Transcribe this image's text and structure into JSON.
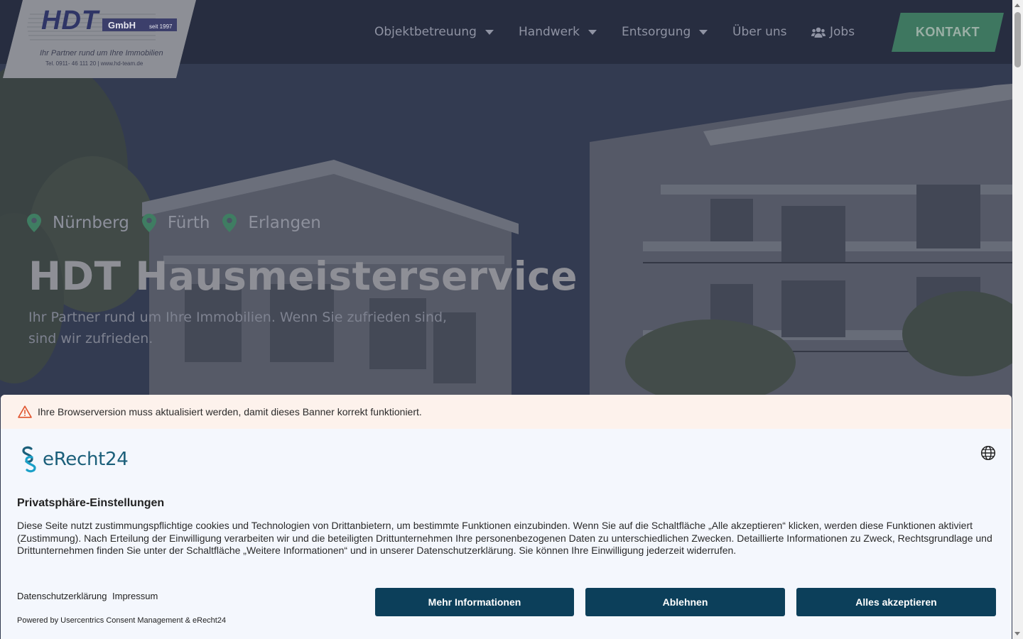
{
  "header": {
    "logo": {
      "brand": "HDT",
      "suffix": "GmbH",
      "since": "seit 1997",
      "tagline": "Ihr Partner rund um Ihre Immobilien",
      "contact": "Tel. 0911- 46 111 20 | www.hd-team.de"
    },
    "nav": [
      {
        "label": "Objektbetreuung",
        "dropdown": true
      },
      {
        "label": "Handwerk",
        "dropdown": true
      },
      {
        "label": "Entsorgung",
        "dropdown": true
      },
      {
        "label": "Über uns",
        "dropdown": false
      },
      {
        "label": "Jobs",
        "icon": "users-icon"
      }
    ],
    "cta_label": "KONTAKT"
  },
  "hero": {
    "locations": [
      "Nürnberg",
      "Fürth",
      "Erlangen"
    ],
    "location_icon": "map-pin-icon",
    "title": "HDT Hausmeisterservice",
    "subtitle": "Ihr Partner rund um Ihre Immobilien. Wenn Sie zufrieden sind, sind wir zufrieden."
  },
  "consent": {
    "warning": "Ihre Browserversion muss aktualisiert werden, damit dieses Banner korrekt funktioniert.",
    "brand": "eRecht24",
    "title": "Privatsphäre-Einstellungen",
    "body": "Diese Seite nutzt zustimmungspflichtige cookies und Technologien von Drittanbietern, um bestimmte Funktionen einzubinden. Wenn Sie auf die Schaltfläche „Alle akzeptieren“ klicken, werden diese Funktionen aktiviert (Zustimmung). Nach Erteilung der Einwilligung verarbeiten wir und die beteiligten Drittunternehmen Ihre personenbezogenen Daten zu unterschiedlichen Zwecken. Detaillierte Informationen zu Zweck, Rechtsgrundlage und Drittunternehmen finden Sie unter der Schaltfläche „Weitere Informationen“ und in unserer Datenschutzerklärung. Sie können Ihre Einwilligung jederzeit widerrufen.",
    "links": [
      "Datenschutzerklärung",
      "Impressum"
    ],
    "powered_by": "Powered by Usercentrics Consent Management & eRecht24",
    "buttons": [
      "Mehr Informationen",
      "Ablehnen",
      "Alles akzeptieren"
    ]
  },
  "colors": {
    "header_bg": "#272d40",
    "accent_green": "#3e7760",
    "consent_button": "#0c3f5a",
    "warning_bg": "#fdf2ec"
  }
}
